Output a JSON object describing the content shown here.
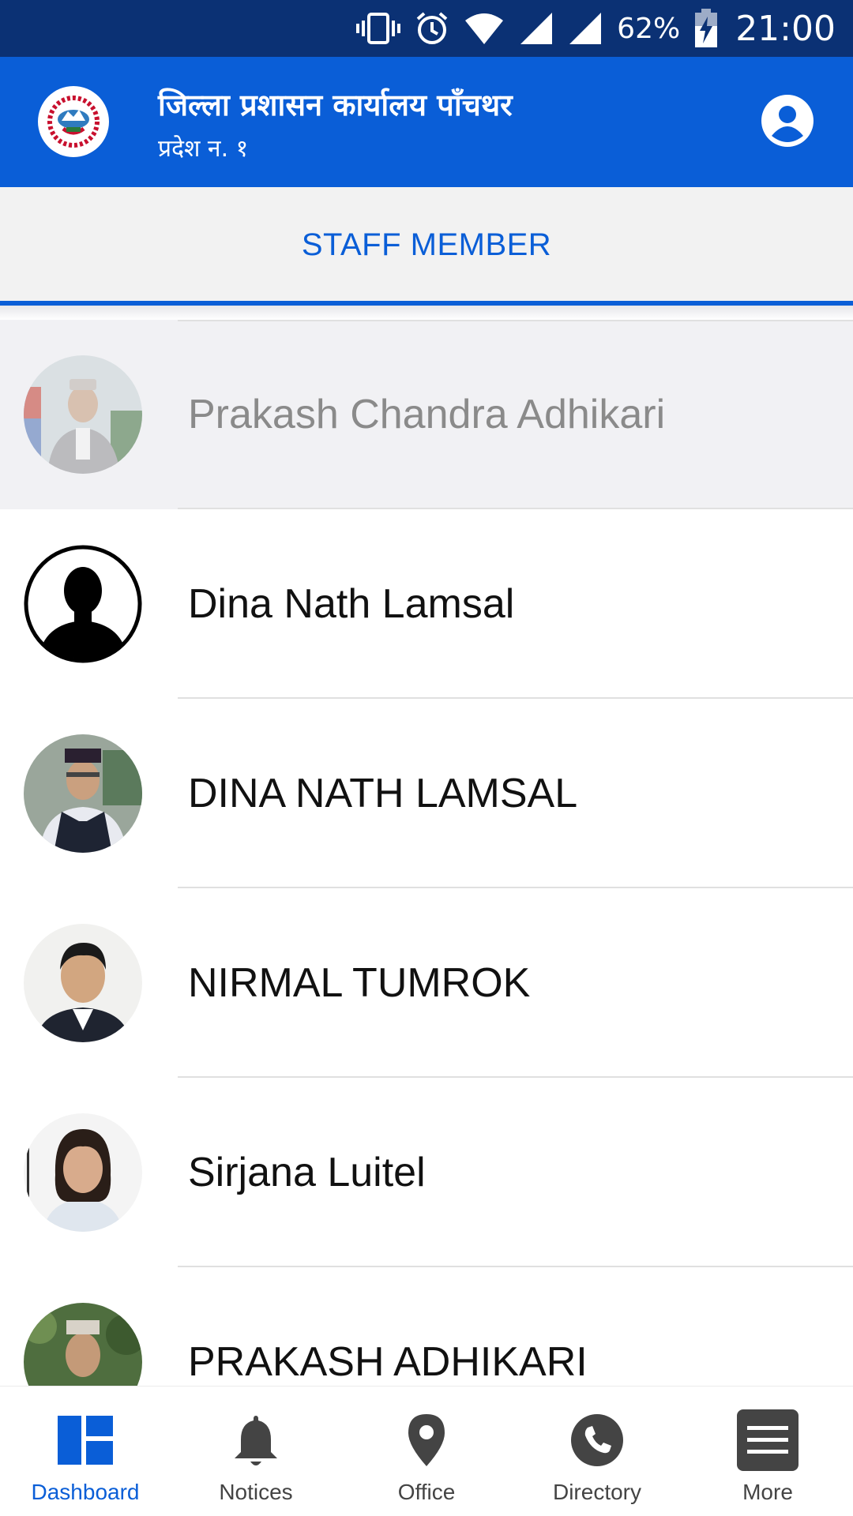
{
  "status_bar": {
    "battery": "62%",
    "time": "21:00"
  },
  "app_bar": {
    "title": "जिल्ला प्रशासन कार्यालय पाँचथर",
    "subtitle": "प्रदेश न. १"
  },
  "tabs": [
    {
      "label": "STAFF MEMBER",
      "active": true
    }
  ],
  "staff": [
    {
      "name": "Prakash Chandra Adhikari",
      "avatar": "photo",
      "selected": true
    },
    {
      "name": "Dina Nath Lamsal",
      "avatar": "placeholder-silhouette",
      "selected": false
    },
    {
      "name": "DINA NATH LAMSAL",
      "avatar": "photo",
      "selected": false
    },
    {
      "name": "NIRMAL TUMROK",
      "avatar": "photo",
      "selected": false
    },
    {
      "name": "Sirjana Luitel",
      "avatar": "photo",
      "selected": false
    },
    {
      "name": "PRAKASH ADHIKARI",
      "avatar": "photo",
      "selected": false
    }
  ],
  "bottom_nav": [
    {
      "label": "Dashboard",
      "icon": "dashboard-icon",
      "active": true
    },
    {
      "label": "Notices",
      "icon": "bell-icon",
      "active": false
    },
    {
      "label": "Office",
      "icon": "location-pin-icon",
      "active": false
    },
    {
      "label": "Directory",
      "icon": "phone-icon",
      "active": false
    },
    {
      "label": "More",
      "icon": "menu-icon",
      "active": false
    }
  ],
  "colors": {
    "status_bar": "#0b3174",
    "primary": "#0a5ed7",
    "tab_background": "#f2f2f2",
    "selected_row": "#f1f1f4",
    "inactive_icon": "#444444"
  }
}
